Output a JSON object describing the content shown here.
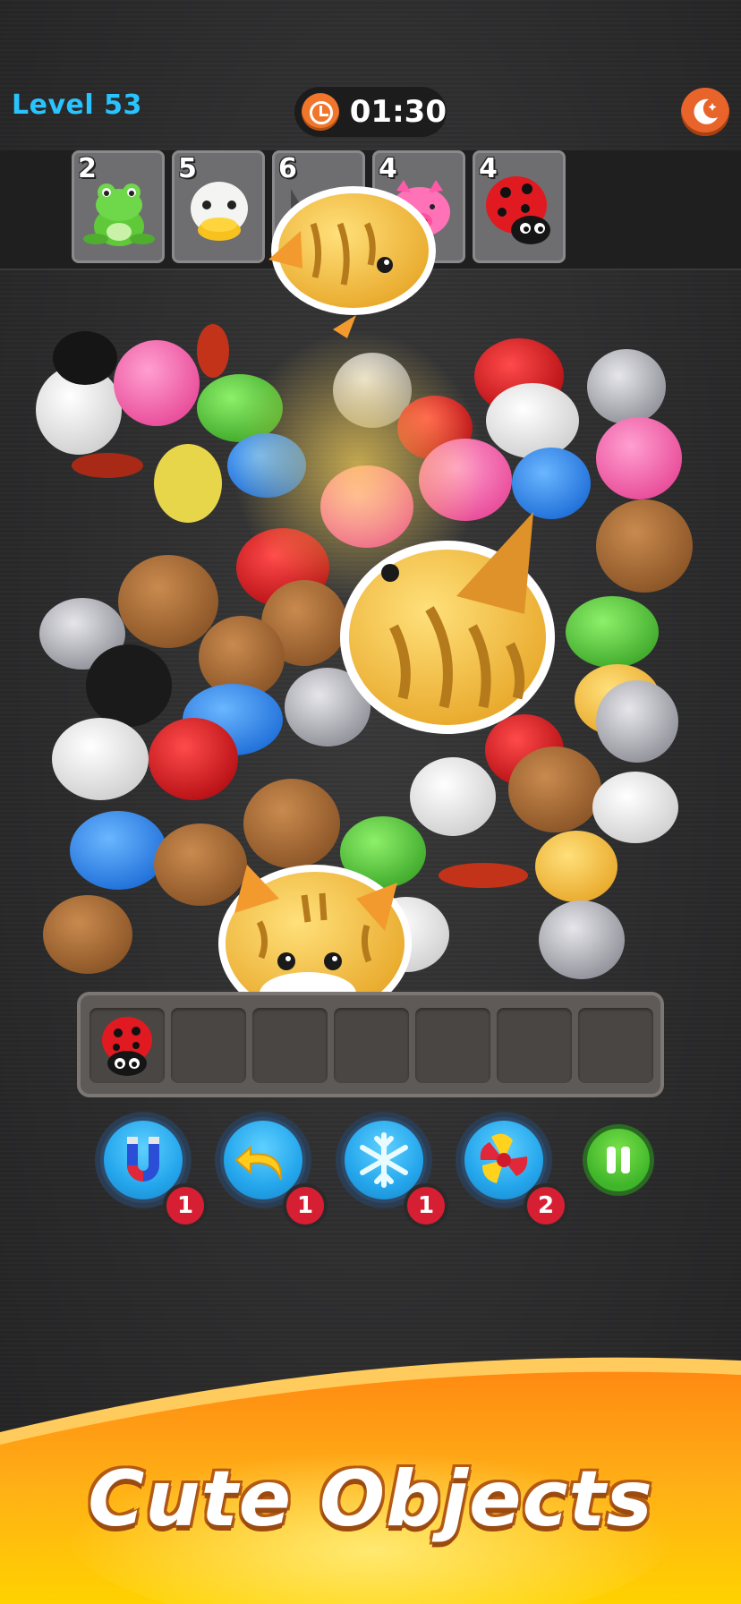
{
  "header": {
    "level_label": "Level 53",
    "timer": "01:30",
    "timer_icon": "clock-icon",
    "night_mode_icon": "moon-star-icon"
  },
  "collection": [
    {
      "count": "2",
      "item": "frog"
    },
    {
      "count": "5",
      "item": "duck"
    },
    {
      "count": "6",
      "item": "cat"
    },
    {
      "count": "4",
      "item": "pig"
    },
    {
      "count": "4",
      "item": "ladybug"
    }
  ],
  "tray": {
    "slots_total": 7,
    "filled": [
      "ladybug"
    ]
  },
  "powerups": [
    {
      "name": "magnet",
      "icon": "magnet-icon",
      "count": "1"
    },
    {
      "name": "undo",
      "icon": "undo-arrow-icon",
      "count": "1"
    },
    {
      "name": "freeze",
      "icon": "snowflake-icon",
      "count": "1"
    },
    {
      "name": "shuffle",
      "icon": "fan-spinner-icon",
      "count": "2"
    }
  ],
  "pause_icon": "pause-icon",
  "banner": {
    "text": "Cute Objects"
  },
  "colors": {
    "level": "#29c4ff",
    "timer_accent": "#f0762b",
    "badge": "#d71f33",
    "banner_top": "#ff9d1c",
    "banner_bottom": "#ffcc00"
  }
}
